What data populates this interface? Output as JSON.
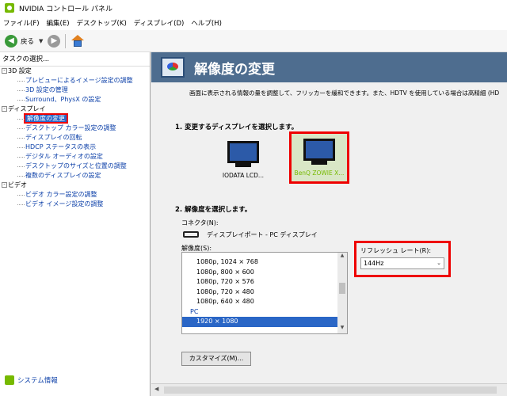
{
  "window": {
    "title": "NVIDIA コントロール パネル"
  },
  "menu": [
    "ファイル(F)",
    "編集(E)",
    "デスクトップ(K)",
    "ディスプレイ(D)",
    "ヘルプ(H)"
  ],
  "toolbar": {
    "back_label": "戻る"
  },
  "left_panel": {
    "header": "タスクの選択...",
    "tree": [
      {
        "text": "3D 設定",
        "kind": "cat",
        "exp": "-"
      },
      {
        "text": "プレビューによるイメージ設定の調整",
        "kind": "sub"
      },
      {
        "text": "3D 設定の管理",
        "kind": "sub"
      },
      {
        "text": "Surround、PhysX の設定",
        "kind": "sub"
      },
      {
        "text": "ディスプレイ",
        "kind": "cat",
        "exp": "-"
      },
      {
        "text": "解像度の変更",
        "kind": "sub",
        "selected": true
      },
      {
        "text": "デスクトップ カラー設定の調整",
        "kind": "sub"
      },
      {
        "text": "ディスプレイの回転",
        "kind": "sub"
      },
      {
        "text": "HDCP ステータスの表示",
        "kind": "sub"
      },
      {
        "text": "デジタル オーディオの設定",
        "kind": "sub"
      },
      {
        "text": "デスクトップのサイズと位置の調整",
        "kind": "sub"
      },
      {
        "text": "複数のディスプレイの設定",
        "kind": "sub"
      },
      {
        "text": "ビデオ",
        "kind": "cat",
        "exp": "-"
      },
      {
        "text": "ビデオ カラー設定の調整",
        "kind": "sub"
      },
      {
        "text": "ビデオ イメージ設定の調整",
        "kind": "sub"
      }
    ],
    "system_info": "システム情報"
  },
  "main": {
    "title": "解像度の変更",
    "description": "画面に表示される情報の量を調整して、フリッカーを緩和できます。また、HDTV を使用している場合は高精細 (HD",
    "step1": "1. 変更するディスプレイを選択します。",
    "monitors": [
      {
        "label": "IODATA LCD..."
      },
      {
        "label": "BenQ ZOWIE X..."
      }
    ],
    "step2": "2. 解像度を選択します。",
    "connector_label": "コネクタ(N):",
    "connector_value": "ディスプレイポート - PC ディスプレイ",
    "resolution_label": "解像度(S):",
    "resolutions": [
      {
        "text": "1080p, 1024 × 768"
      },
      {
        "text": "1080p, 800 × 600"
      },
      {
        "text": "1080p, 720 × 576"
      },
      {
        "text": "1080p, 720 × 480"
      },
      {
        "text": "1080p, 640 × 480"
      },
      {
        "text": "PC",
        "group": true
      },
      {
        "text": "1920 × 1080",
        "selected": true
      }
    ],
    "refresh_label": "リフレッシュ レート(R):",
    "refresh_value": "144Hz",
    "customize_button": "カスタマイズ(M)..."
  }
}
